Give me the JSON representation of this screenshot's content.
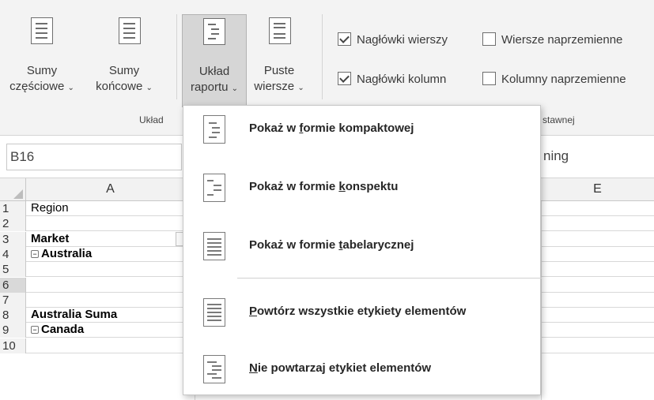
{
  "ribbon": {
    "buttons": [
      {
        "line1": "Sumy",
        "line2": "częściowe",
        "chevron": "⌄",
        "icon": "subtotals-icon"
      },
      {
        "line1": "Sumy",
        "line2": "końcowe",
        "chevron": "⌄",
        "icon": "grand-totals-icon"
      },
      {
        "line1": "Układ",
        "line2": "raportu",
        "chevron": "⌄",
        "icon": "report-layout-icon"
      },
      {
        "line1": "Puste",
        "line2": "wiersze",
        "chevron": "⌄",
        "icon": "blank-rows-icon"
      }
    ],
    "group_label_layout": "Układ",
    "group_label_style": "stawnej",
    "checkboxes": [
      {
        "label": "Nagłówki wierszy",
        "checked": true
      },
      {
        "label": "Wiersze naprzemienne",
        "checked": false
      },
      {
        "label": "Nagłówki kolumn",
        "checked": true
      },
      {
        "label": "Kolumny naprzemienne",
        "checked": false
      }
    ]
  },
  "formula_bar": {
    "name_box": "B16",
    "content": "ning"
  },
  "grid": {
    "columns": [
      "A",
      "E"
    ],
    "rows": [
      {
        "num": "1",
        "a": "Region",
        "bold": false,
        "collapse": false
      },
      {
        "num": "2",
        "a": "",
        "bold": false,
        "collapse": false
      },
      {
        "num": "3",
        "a": "Market",
        "bold": true,
        "collapse": false
      },
      {
        "num": "4",
        "a": "Australia",
        "bold": true,
        "collapse": true
      },
      {
        "num": "5",
        "a": "",
        "bold": false,
        "collapse": false
      },
      {
        "num": "6",
        "a": "",
        "bold": false,
        "collapse": false
      },
      {
        "num": "7",
        "a": "",
        "bold": false,
        "collapse": false
      },
      {
        "num": "8",
        "a": "Australia Suma",
        "bold": true,
        "collapse": false
      },
      {
        "num": "9",
        "a": "Canada",
        "bold": true,
        "collapse": true
      },
      {
        "num": "10",
        "a": "",
        "bold": false,
        "collapse": false
      }
    ],
    "selected_row": "6",
    "collapse_glyph": "−"
  },
  "menu": {
    "items": [
      {
        "pre": "Pokaż w ",
        "key": "f",
        "post": "ormie kompaktowej",
        "icon": "compact-form-icon"
      },
      {
        "pre": "Pokaż w formie ",
        "key": "k",
        "post": "onspektu",
        "icon": "outline-form-icon"
      },
      {
        "pre": "Pokaż w formie ",
        "key": "t",
        "post": "abelarycznej",
        "icon": "tabular-form-icon"
      },
      {
        "pre": "",
        "key": "P",
        "post": "owtórz wszystkie etykiety elementów",
        "icon": "repeat-labels-icon"
      },
      {
        "pre": "",
        "key": "N",
        "post": "ie powtarzaj etykiet elementów",
        "icon": "no-repeat-labels-icon"
      }
    ]
  }
}
